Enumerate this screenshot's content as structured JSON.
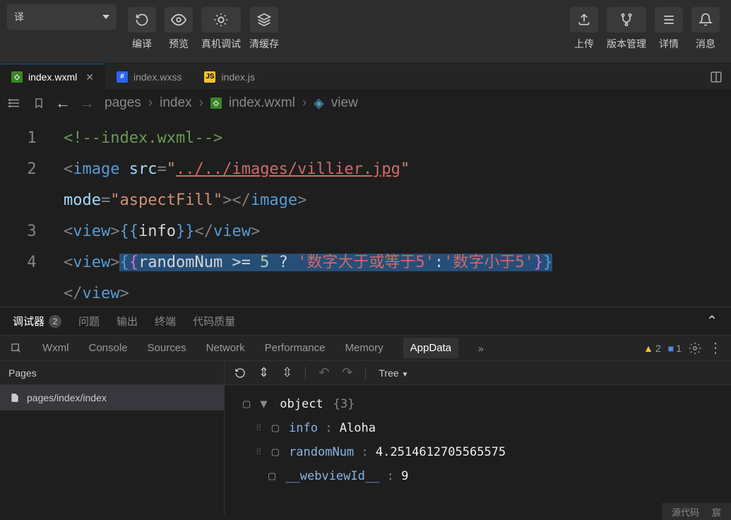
{
  "toolbar": {
    "compile": "编译",
    "preview": "预览",
    "realdevice": "真机调试",
    "clearcache": "清缓存",
    "upload": "上传",
    "version": "版本管理",
    "details": "详情",
    "message": "消息"
  },
  "tabs": [
    {
      "name": "index.wxml",
      "icon": "wxml",
      "active": true,
      "close": true
    },
    {
      "name": "index.wxss",
      "icon": "wxss",
      "active": false,
      "close": false
    },
    {
      "name": "index.js",
      "icon": "js",
      "active": false,
      "close": false
    }
  ],
  "breadcrumb": {
    "p0": "pages",
    "p1": "index",
    "p2": "index.wxml",
    "p3": "view"
  },
  "code": {
    "l1_comment": "<!--index.wxml-->",
    "l2_tag": "image",
    "l2_attr_src": "src",
    "l2_src_val": "../../images/villier.jpg",
    "l2_attr_mode": "mode",
    "l2_mode_val": "aspectFill",
    "l3_tag": "view",
    "l3_expr": "info",
    "l4_tag": "view",
    "l4_expr_var": "randomNum",
    "l4_op": ">=",
    "l4_num": "5",
    "l4_q": "?",
    "l4_s1": "数字大于或等于5",
    "l4_colon": ":",
    "l4_s2": "数字小于5"
  },
  "debugger": {
    "tab_debugger": "调试器",
    "badge": "2",
    "tab_problems": "问题",
    "tab_output": "输出",
    "tab_terminal": "终端",
    "tab_quality": "代码质量"
  },
  "devtools": {
    "wxml": "Wxml",
    "console": "Console",
    "sources": "Sources",
    "network": "Network",
    "performance": "Performance",
    "memory": "Memory",
    "appdata": "AppData",
    "warn_count": "2",
    "info_count": "1"
  },
  "pages": {
    "header": "Pages",
    "item": "pages/index/index"
  },
  "data_toolbar": {
    "tree": "Tree"
  },
  "tree": {
    "root": "object",
    "root_count": "{3}",
    "k1": "info",
    "v1": "Aloha",
    "k2": "randomNum",
    "v2": "4.2514612705565575",
    "k3": "__webviewId__",
    "v3": "9"
  },
  "status": {
    "src": "源代码",
    "user": "宸"
  }
}
